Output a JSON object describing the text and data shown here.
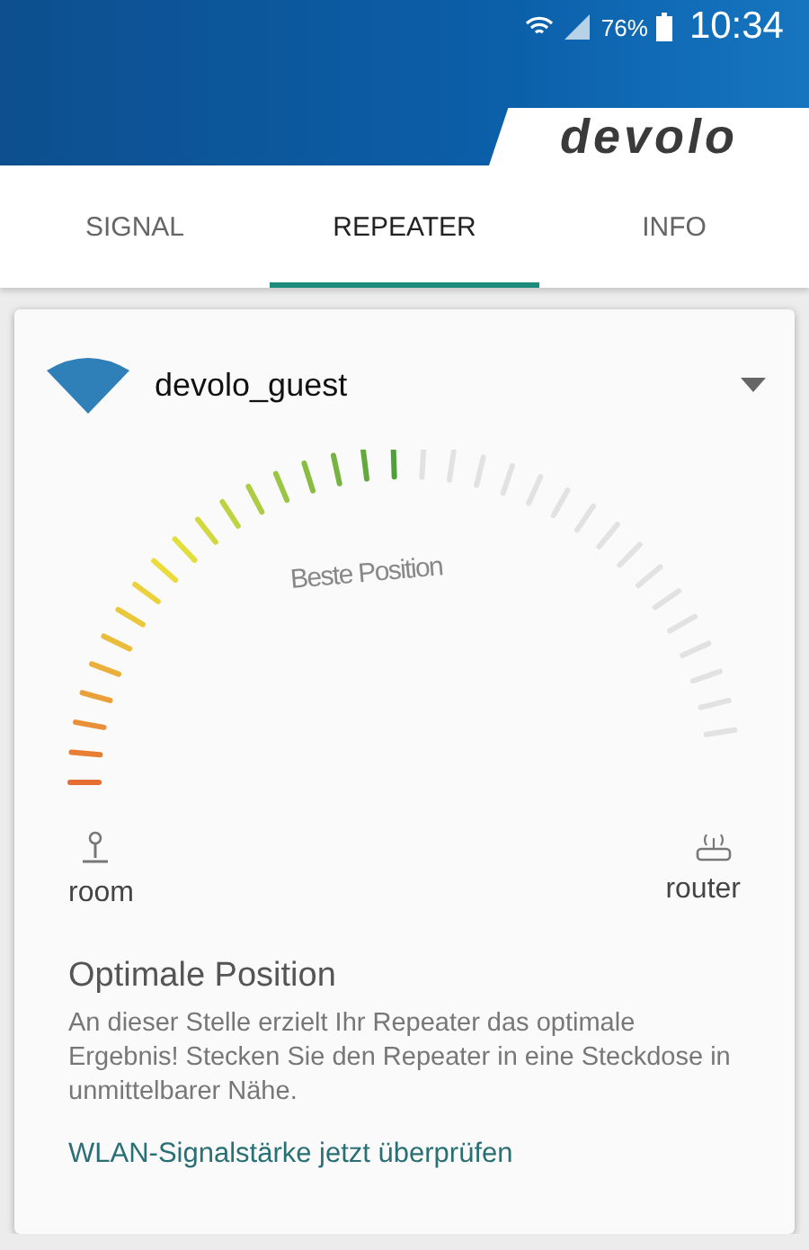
{
  "status_bar": {
    "battery": "76%",
    "time": "10:34"
  },
  "header": {
    "logo": "devolo"
  },
  "tabs": [
    {
      "label": "SIGNAL",
      "selected": false
    },
    {
      "label": "REPEATER",
      "selected": true
    },
    {
      "label": "INFO",
      "selected": false
    }
  ],
  "card": {
    "network": "devolo_guest",
    "gauge": {
      "level": 0.53,
      "label": "Beste Position"
    },
    "left_label": "room",
    "right_label": "router",
    "title": "Optimale Position",
    "body": "An dieser Stelle erzielt Ihr Repeater das optimale Ergebnis! Stecken Sie den Repeater in eine Steckdose in unmittelbarer Nähe.",
    "link": "WLAN-Signalstärke jetzt überprüfen"
  }
}
